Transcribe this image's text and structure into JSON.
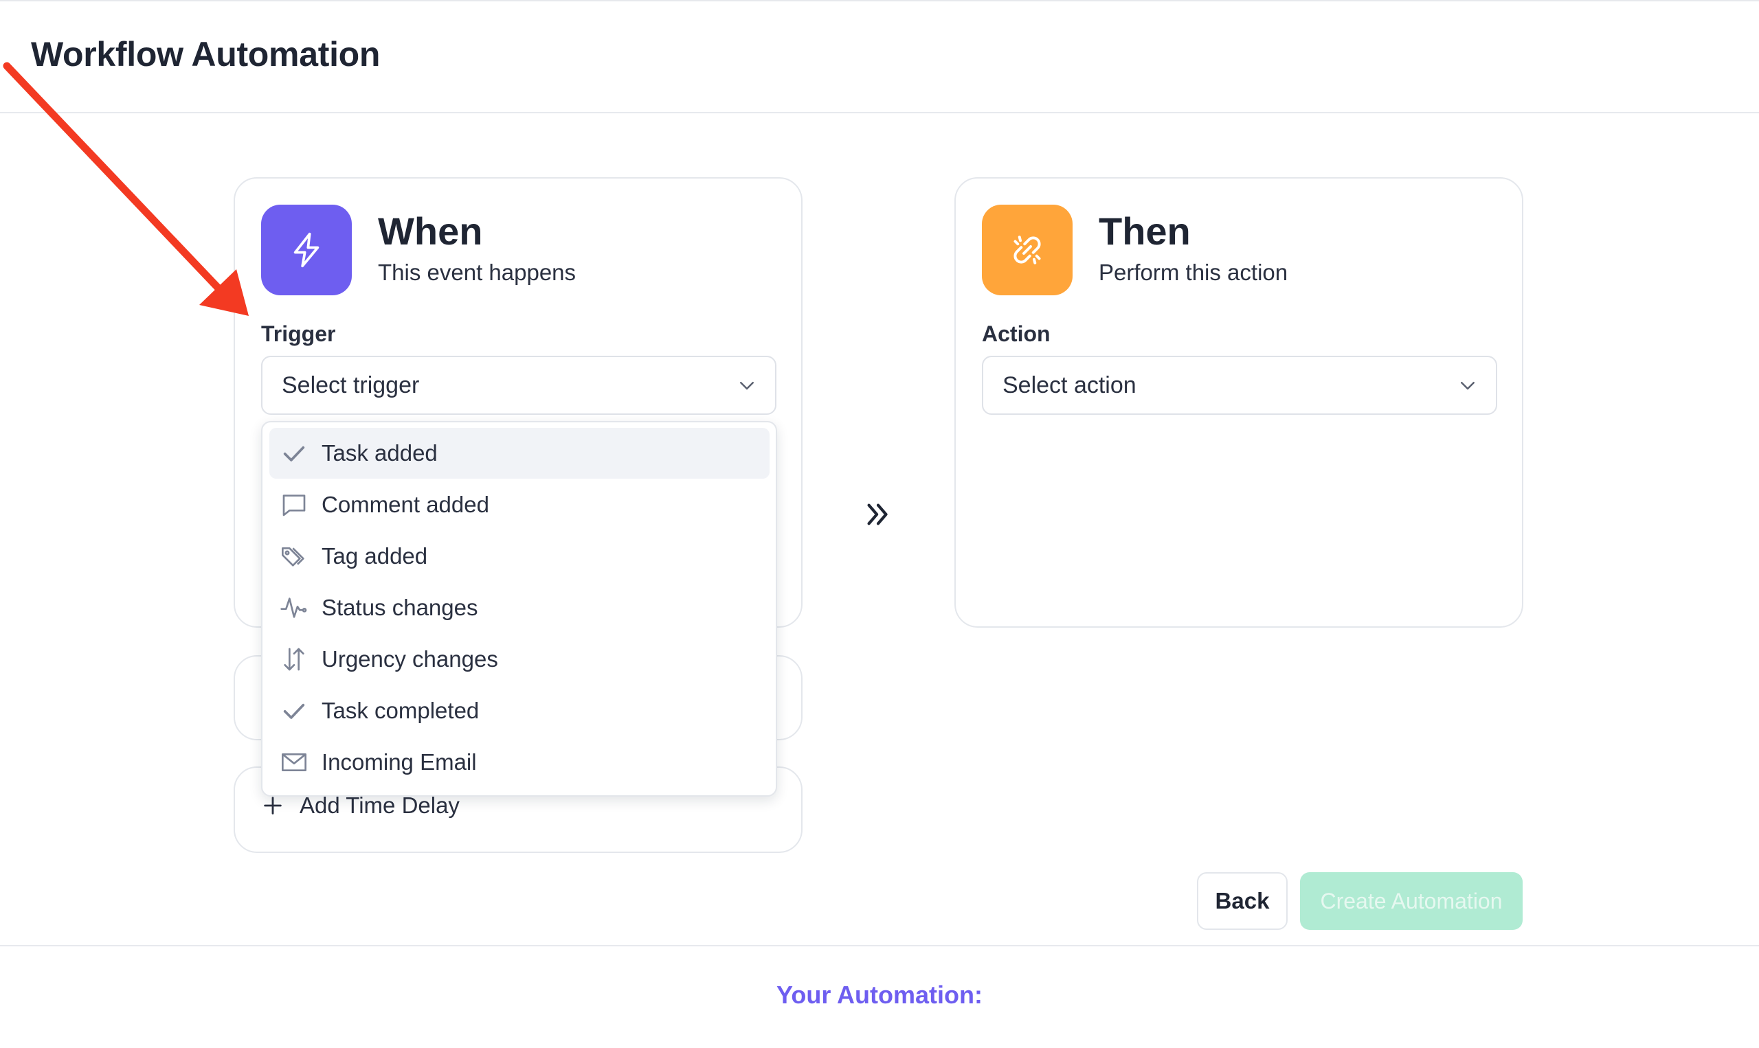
{
  "app": {
    "title": "Workflow Automation"
  },
  "when_card": {
    "heading": "When",
    "subtitle": "This event happens",
    "icon": "lightning-icon",
    "field_label": "Trigger",
    "select_placeholder": "Select trigger"
  },
  "then_card": {
    "heading": "Then",
    "subtitle": "Perform this action",
    "icon": "link-icon",
    "field_label": "Action",
    "select_placeholder": "Select action"
  },
  "trigger_options": [
    {
      "label": "Task added",
      "icon": "check-icon",
      "highlighted": true
    },
    {
      "label": "Comment added",
      "icon": "comment-icon"
    },
    {
      "label": "Tag added",
      "icon": "tag-icon"
    },
    {
      "label": "Status changes",
      "icon": "activity-icon"
    },
    {
      "label": "Urgency changes",
      "icon": "sort-arrows-icon"
    },
    {
      "label": "Task completed",
      "icon": "check-icon"
    },
    {
      "label": "Incoming Email",
      "icon": "mail-icon"
    }
  ],
  "time_delay": {
    "label": "Add Time Delay"
  },
  "buttons": {
    "back": "Back",
    "create": "Create Automation"
  },
  "summary": {
    "title": "Your Automation:"
  },
  "colors": {
    "accent_purple": "#6e5ef0",
    "accent_orange": "#ffa53a",
    "create_button_disabled": "#b0ebd3",
    "annotation_arrow": "#f33a22"
  }
}
